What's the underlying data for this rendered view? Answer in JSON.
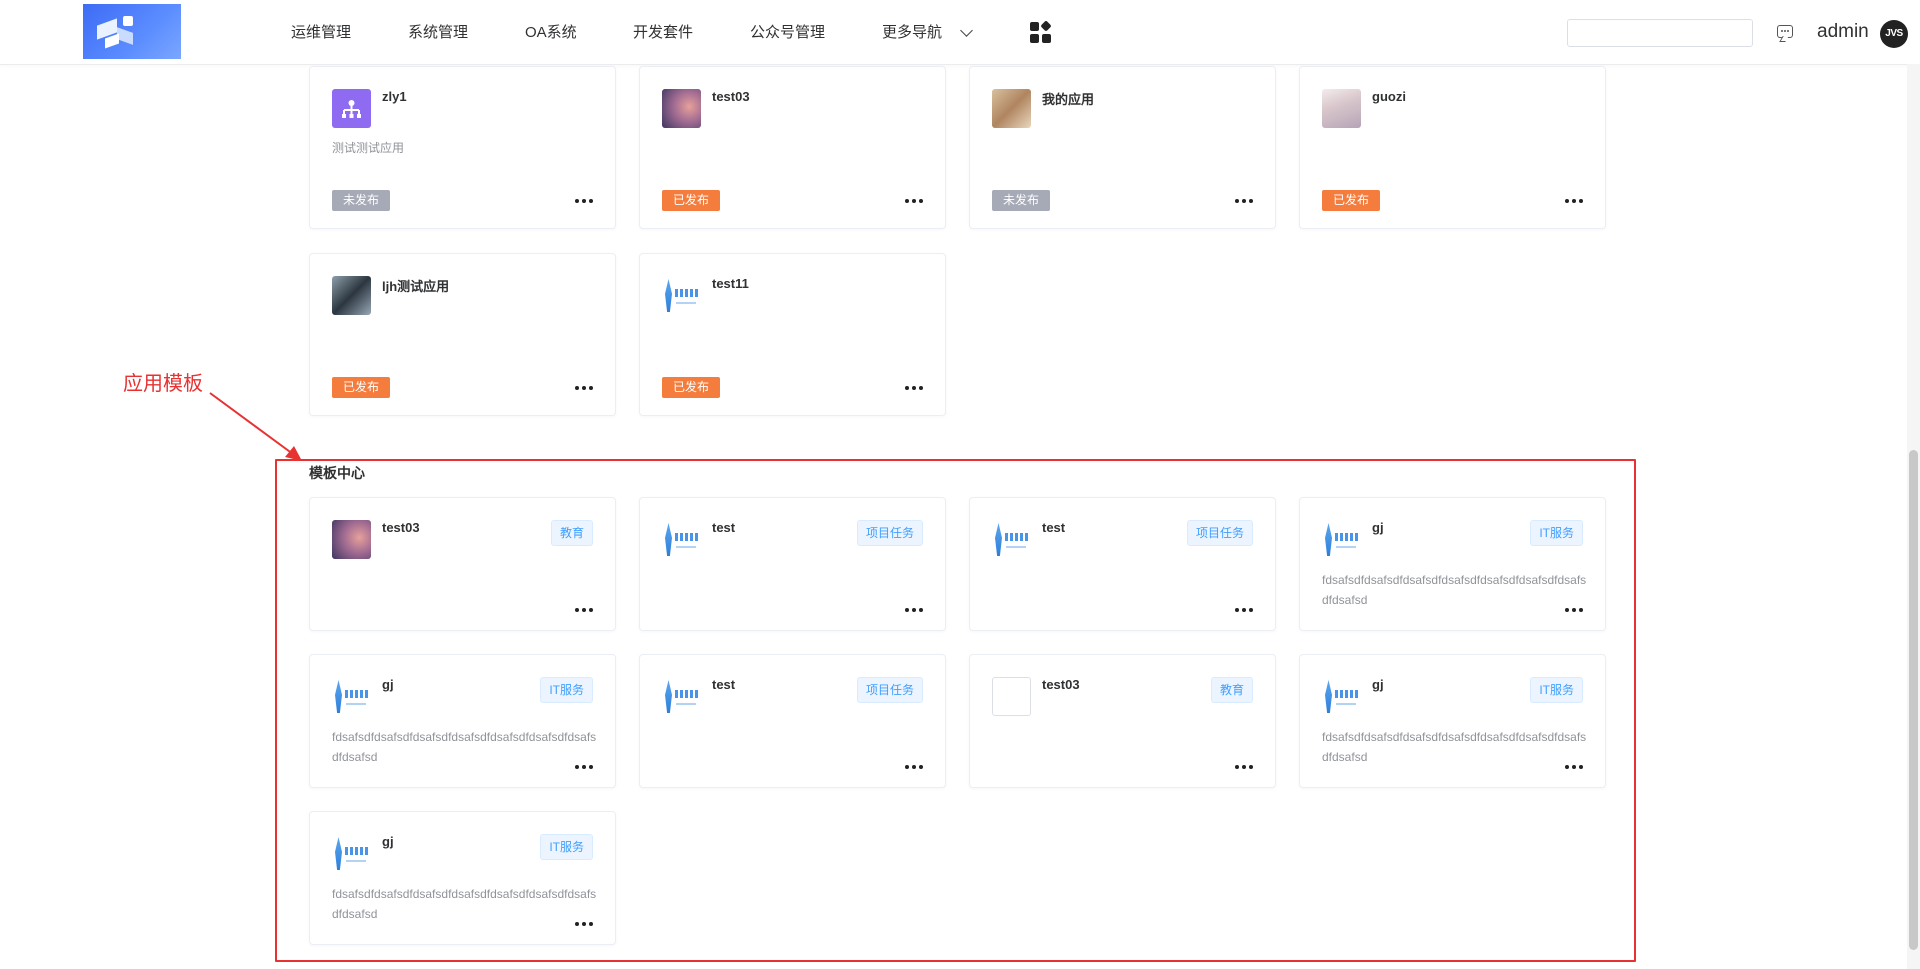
{
  "nav": {
    "items": [
      "运维管理",
      "系统管理",
      "OA系统",
      "开发套件",
      "公众号管理",
      "更多导航"
    ]
  },
  "user": {
    "name": "admin",
    "avatar_text": "JVS"
  },
  "apps": [
    {
      "title": "zly1",
      "desc": "测试测试应用",
      "status": "未发布",
      "icon": "network-icon"
    },
    {
      "title": "test03",
      "desc": "",
      "status": "已发布",
      "icon": "gradient-icon"
    },
    {
      "title": "我的应用",
      "desc": "",
      "status": "未发布",
      "icon": "photo-icon"
    },
    {
      "title": "guozi",
      "desc": "",
      "status": "已发布",
      "icon": "photo-icon"
    },
    {
      "title": "ljh测试应用",
      "desc": "",
      "status": "已发布",
      "icon": "photo-icon"
    },
    {
      "title": "test11",
      "desc": "",
      "status": "已发布",
      "icon": "rocket-logo-icon"
    }
  ],
  "annotation": {
    "label": "应用模板"
  },
  "template_section": {
    "title": "模板中心"
  },
  "templates": [
    {
      "title": "test03",
      "tag": "教育",
      "desc": "",
      "icon": "gradient-icon"
    },
    {
      "title": "test",
      "tag": "项目任务",
      "desc": "",
      "icon": "rocket-logo-icon"
    },
    {
      "title": "test",
      "tag": "项目任务",
      "desc": "",
      "icon": "rocket-logo-icon"
    },
    {
      "title": "gj",
      "tag": "IT服务",
      "desc": "fdsafsdfdsafsdfdsafsdfdsafsdfdsafsdfdsafsdfdsafsdfdsafsd",
      "icon": "rocket-logo-icon"
    },
    {
      "title": "gj",
      "tag": "IT服务",
      "desc": "fdsafsdfdsafsdfdsafsdfdsafsdfdsafsdfdsafsdfdsafsdfdsafsd",
      "icon": "rocket-logo-icon"
    },
    {
      "title": "test",
      "tag": "项目任务",
      "desc": "",
      "icon": "rocket-logo-icon"
    },
    {
      "title": "test03",
      "tag": "教育",
      "desc": "",
      "icon": "blank-icon"
    },
    {
      "title": "gj",
      "tag": "IT服务",
      "desc": "fdsafsdfdsafsdfdsafsdfdsafsdfdsafsdfdsafsdfdsafsdfdsafsd",
      "icon": "rocket-logo-icon"
    },
    {
      "title": "gj",
      "tag": "IT服务",
      "desc": "fdsafsdfdsafsdfdsafsdfdsafsdfdsafsdfdsafsdfdsafsdfdsafsd",
      "icon": "rocket-logo-icon"
    }
  ],
  "colors": {
    "published": "#f47c3c",
    "unpublished": "#a6a9b6",
    "tag_blue": "#409eff",
    "annotation_red": "#e83232"
  }
}
